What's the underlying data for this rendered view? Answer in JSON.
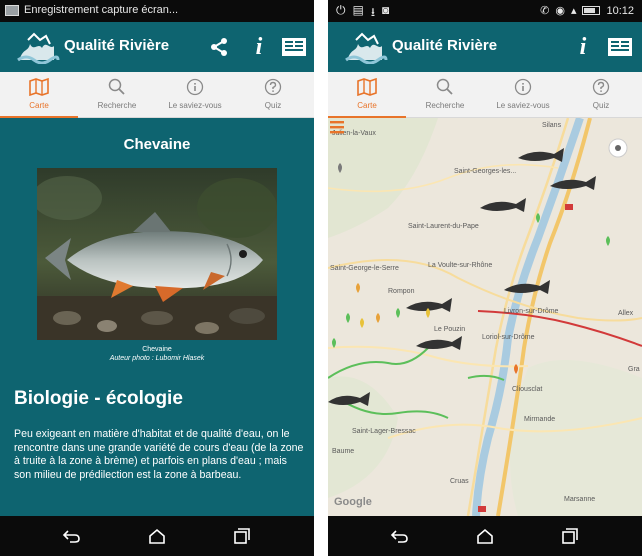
{
  "left_screen": {
    "status_text": "Enregistrement capture écran...",
    "app_title": "Qualité Rivière",
    "tabs": [
      {
        "label": "Carte",
        "active": true
      },
      {
        "label": "Recherche",
        "active": false
      },
      {
        "label": "Le saviez-vous",
        "active": false
      },
      {
        "label": "Quiz",
        "active": false
      }
    ],
    "species_name": "Chevaine",
    "photo_caption": "Chevaine",
    "photo_author": "Auteur photo : Lubomir Hlasek",
    "section_heading": "Biologie - écologie",
    "body_text": "Peu exigeant en matière d'habitat et de qualité d'eau, on le rencontre dans une grande variété de cours d'eau (de la zone à truite à la zone à brème) et parfois en plans d'eau ; mais son milieu de prédilection est la zone à barbeau."
  },
  "right_screen": {
    "status_time": "10:12",
    "app_title": "Qualité Rivière",
    "tabs": [
      {
        "label": "Carte",
        "active": true
      },
      {
        "label": "Recherche",
        "active": false
      },
      {
        "label": "Le saviez-vous",
        "active": false
      },
      {
        "label": "Quiz",
        "active": false
      }
    ],
    "map_labels": {
      "julien": "Julien-la-Vaux",
      "sillans": "Silans",
      "saint_georges": "Saint-Georges-les...",
      "saint_laurent": "Saint-Laurent-du-Pape",
      "saint_george_serre": "Saint-George-le-Serre",
      "voulte": "La Voulte-sur-Rhône",
      "livron": "Livron-sur-Drôme",
      "allex": "Allex",
      "rompon": "Rompon",
      "le_pouzin": "Le Pouzin",
      "loriol": "Loriol-sur-Drôme",
      "cliousclat": "Cliousclat",
      "mirmande": "Mirmande",
      "saint_lager": "Saint-Lager-Bressac",
      "baume": "Baume",
      "cruas": "Cruas",
      "marsanne": "Marsanne",
      "grane": "Gra"
    },
    "google_text": "Google"
  },
  "colors": {
    "primary": "#0e6470",
    "accent": "#e8742a",
    "map_bg": "#ece7dc"
  }
}
